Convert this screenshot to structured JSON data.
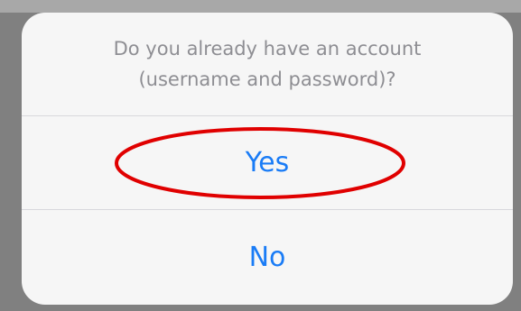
{
  "dialog": {
    "message_line1": "Do you already have an account",
    "message_line2": "(username and password)?",
    "options": [
      {
        "label": "Yes",
        "highlighted": true
      },
      {
        "label": "No",
        "highlighted": false
      }
    ]
  },
  "colors": {
    "backdrop": "#808080",
    "sheet": "#f6f6f6",
    "message_text": "#8e8e93",
    "option_text": "#1a7cf6",
    "divider": "#d8d8dc",
    "highlight_annotation": "#e00000"
  }
}
